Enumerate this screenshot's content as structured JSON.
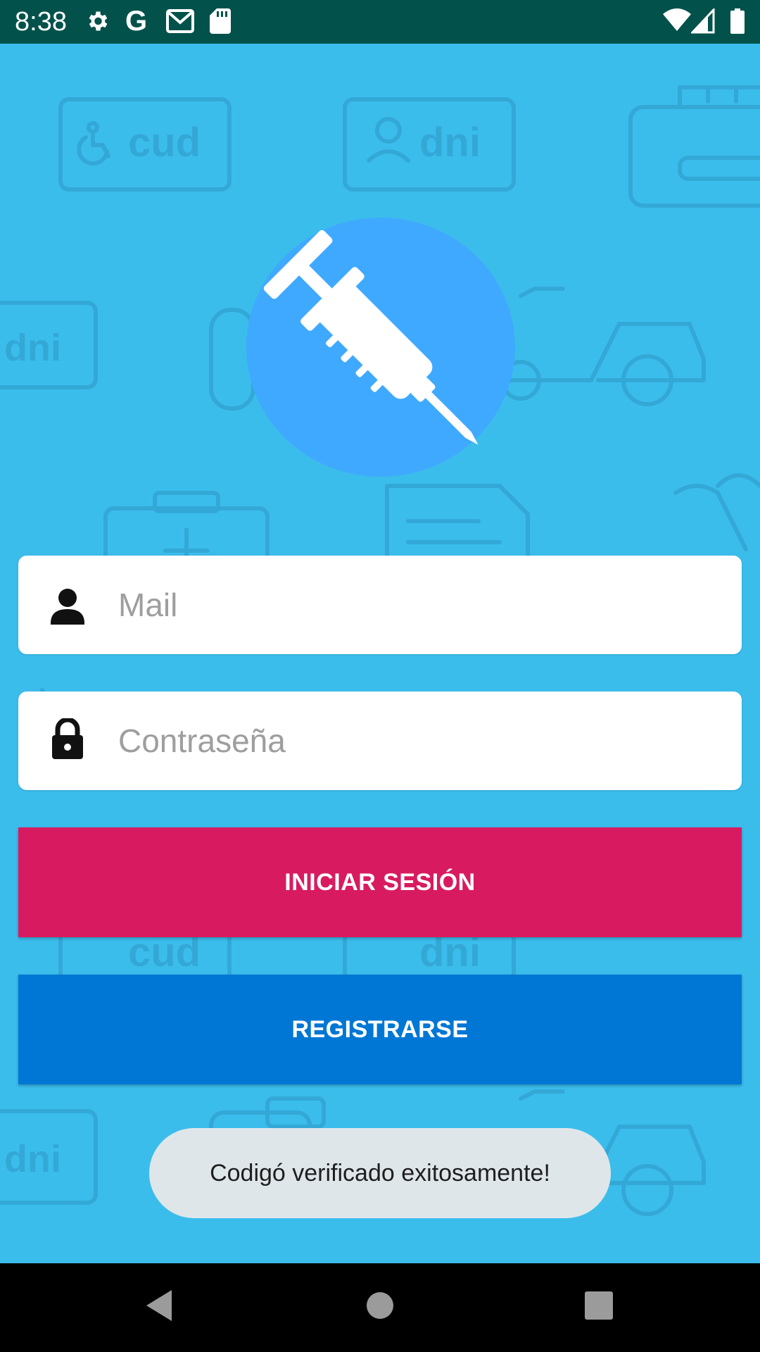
{
  "status_bar": {
    "time": "8:38",
    "left_icons": [
      "gear-icon",
      "google-icon",
      "gmail-icon",
      "sd-card-icon"
    ],
    "right_icons": [
      "wifi-icon",
      "signal-icon",
      "battery-icon"
    ]
  },
  "background": {
    "color": "#3bbdec",
    "pattern_labels": {
      "cud": "cud",
      "dni": "dni"
    }
  },
  "logo": {
    "icon": "syringe-icon",
    "circle_color": "#3fa9ff"
  },
  "form": {
    "mail": {
      "icon": "person-icon",
      "placeholder": "Mail",
      "value": ""
    },
    "password": {
      "icon": "lock-icon",
      "placeholder": "Contraseña",
      "value": ""
    }
  },
  "buttons": {
    "login_label": "INICIAR SESIÓN",
    "login_color": "#d81b60",
    "register_label": "REGISTRARSE",
    "register_color": "#0077d4"
  },
  "toast": {
    "message": "Codigó verificado exitosamente!"
  },
  "nav_bar": {
    "buttons": [
      "back-icon",
      "home-icon",
      "recents-icon"
    ]
  }
}
